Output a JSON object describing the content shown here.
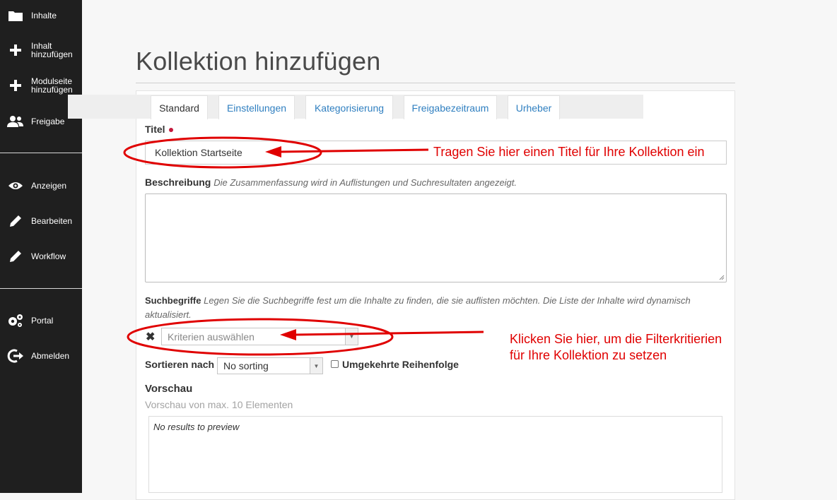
{
  "sidebar": {
    "items": [
      {
        "label": "Inhalte",
        "icon": "folder-icon"
      },
      {
        "label": "Inhalt\nhinzufügen",
        "icon": "plus-icon"
      },
      {
        "label": "Modulseite\nhinzufügen",
        "icon": "plus-icon"
      },
      {
        "label": "Freigabe",
        "icon": "users-icon"
      },
      {
        "label": "Anzeigen",
        "icon": "eye-icon"
      },
      {
        "label": "Bearbeiten",
        "icon": "pencil-icon"
      },
      {
        "label": "Workflow",
        "icon": "pencil-icon"
      },
      {
        "label": "Portal",
        "icon": "gears-icon"
      },
      {
        "label": "Abmelden",
        "icon": "logout-icon"
      }
    ]
  },
  "page": {
    "title": "Kollektion hinzufügen"
  },
  "tabs": [
    {
      "label": "Standard",
      "active": true
    },
    {
      "label": "Einstellungen",
      "active": false
    },
    {
      "label": "Kategorisierung",
      "active": false
    },
    {
      "label": "Freigabezeitraum",
      "active": false
    },
    {
      "label": "Urheber",
      "active": false
    }
  ],
  "form": {
    "title_label": "Titel",
    "title_value": "Kollektion Startseite",
    "description_label": "Beschreibung",
    "description_help": "Die Zusammenfassung wird in Auflistungen und Suchresultaten angezeigt.",
    "search_label": "Suchbegriffe",
    "search_help": "Legen Sie die Suchbegriffe fest um die Inhalte zu finden, die sie auflisten möchten. Die Liste der Inhalte wird dynamisch aktualisiert.",
    "criteria_placeholder": "Kriterien auswählen",
    "clear_symbol": "✖",
    "sort_label": "Sortieren nach",
    "sort_value": "No sorting",
    "reverse_label": "Umgekehrte Reihenfolge",
    "preview_title": "Vorschau",
    "preview_sub": "Vorschau von max. 10 Elementen",
    "preview_empty": "No results to preview"
  },
  "annotations": {
    "title_hint": "Tragen Sie hier einen Titel für Ihre Kollektion ein",
    "criteria_hint_line1": "Klicken Sie hier, um die Filterkritierien",
    "criteria_hint_line2": "für Ihre Kollektion zu setzen",
    "color": "#e00000"
  },
  "colors": {
    "sidebar_bg": "#1f1f1f",
    "link": "#2f7fc0",
    "required": "#c4183c"
  }
}
